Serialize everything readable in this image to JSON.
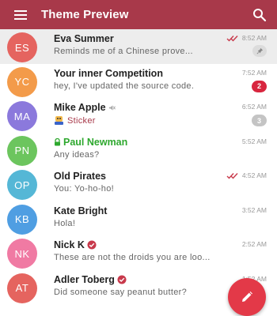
{
  "appbar": {
    "title": "Theme Preview"
  },
  "colors": {
    "accent": "#a8394a",
    "fab": "#e33948",
    "secret": "#2ea82e"
  },
  "chats": [
    {
      "initials": "ES",
      "avatar_color": "#e5645f",
      "name": "Eva Summer",
      "message": "Reminds me of a Chinese prove...",
      "time": "8:52 AM",
      "read": true,
      "pinned": true,
      "highlight": true
    },
    {
      "initials": "YC",
      "avatar_color": "#f39b4a",
      "name": "Your inner Competition",
      "message": "hey, I've updated the source code.",
      "time": "7:52 AM",
      "unread": "2",
      "unread_style": "red"
    },
    {
      "initials": "MA",
      "avatar_color": "#8b79dc",
      "name": "Mike Apple",
      "message": "Sticker",
      "time": "6:52 AM",
      "unread": "3",
      "unread_style": "gray",
      "muted": true,
      "sticker": true
    },
    {
      "initials": "PN",
      "avatar_color": "#6cc55e",
      "name": "Paul Newman",
      "message": "Any ideas?",
      "time": "5:52 AM",
      "secret": true
    },
    {
      "initials": "OP",
      "avatar_color": "#55b7d6",
      "name": "Old Pirates",
      "message": "You: Yo-ho-ho!",
      "time": "4:52 AM",
      "read": true
    },
    {
      "initials": "KB",
      "avatar_color": "#4f9ee2",
      "name": "Kate Bright",
      "message": "Hola!",
      "time": "3:52 AM"
    },
    {
      "initials": "NK",
      "avatar_color": "#f07aa3",
      "name": "Nick K",
      "message": "These are not the droids you are loo...",
      "time": "2:52 AM",
      "verified": true
    },
    {
      "initials": "AT",
      "avatar_color": "#e5645f",
      "name": "Adler Toberg",
      "message": "Did someone say peanut butter?",
      "time": "1:52 AM",
      "verified": true
    }
  ]
}
